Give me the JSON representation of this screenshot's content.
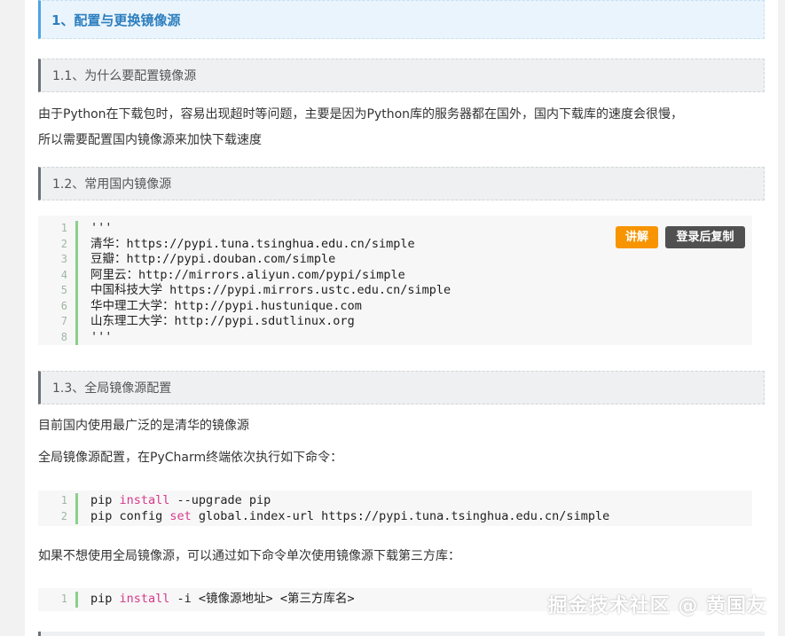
{
  "section1": {
    "title": "1、配置与更换镜像源"
  },
  "section1_1": {
    "title": "1.1、为什么要配置镜像源",
    "para_line1": "由于Python在下载包时，容易出现超时等问题，主要是因为Python库的服务器都在国外，国内下载库的速度会很慢，",
    "para_line2": "所以需要配置国内镜像源来加快下载速度"
  },
  "section1_2": {
    "title": "1.2、常用国内镜像源",
    "code": [
      {
        "n": "1",
        "text": "'''"
      },
      {
        "n": "2",
        "text": "清华：https://pypi.tuna.tsinghua.edu.cn/simple"
      },
      {
        "n": "3",
        "text": "豆瓣：http://pypi.douban.com/simple"
      },
      {
        "n": "4",
        "text": "阿里云：http://mirrors.aliyun.com/pypi/simple"
      },
      {
        "n": "5",
        "text": "中国科技大学 https://pypi.mirrors.ustc.edu.cn/simple"
      },
      {
        "n": "6",
        "text": "华中理工大学：http://pypi.hustunique.com"
      },
      {
        "n": "7",
        "text": "山东理工大学：http://pypi.sdutlinux.org"
      },
      {
        "n": "8",
        "text": "'''"
      }
    ],
    "explain_button": "讲解",
    "copy_button": "登录后复制"
  },
  "section1_3": {
    "title": "1.3、全局镜像源配置",
    "para1": "目前国内使用最广泛的是清华的镜像源",
    "para2": "全局镜像源配置，在PyCharm终端依次执行如下命令：",
    "code": [
      {
        "n": "1",
        "a": "pip ",
        "kw": "install",
        "b": " --upgrade pip"
      },
      {
        "n": "2",
        "a": "pip config ",
        "kw": "set",
        "b": " global.index-url https://pypi.tuna.tsinghua.edu.cn/simple"
      }
    ],
    "para3": "如果不想使用全局镜像源，可以通过如下命令单次使用镜像源下载第三方库：",
    "code2": [
      {
        "n": "1",
        "a": "pip ",
        "kw": "install",
        "b": " -i <镜像源地址> <第三方库名>"
      }
    ]
  },
  "watermark": "掘金技术社区 @ 黄国友"
}
